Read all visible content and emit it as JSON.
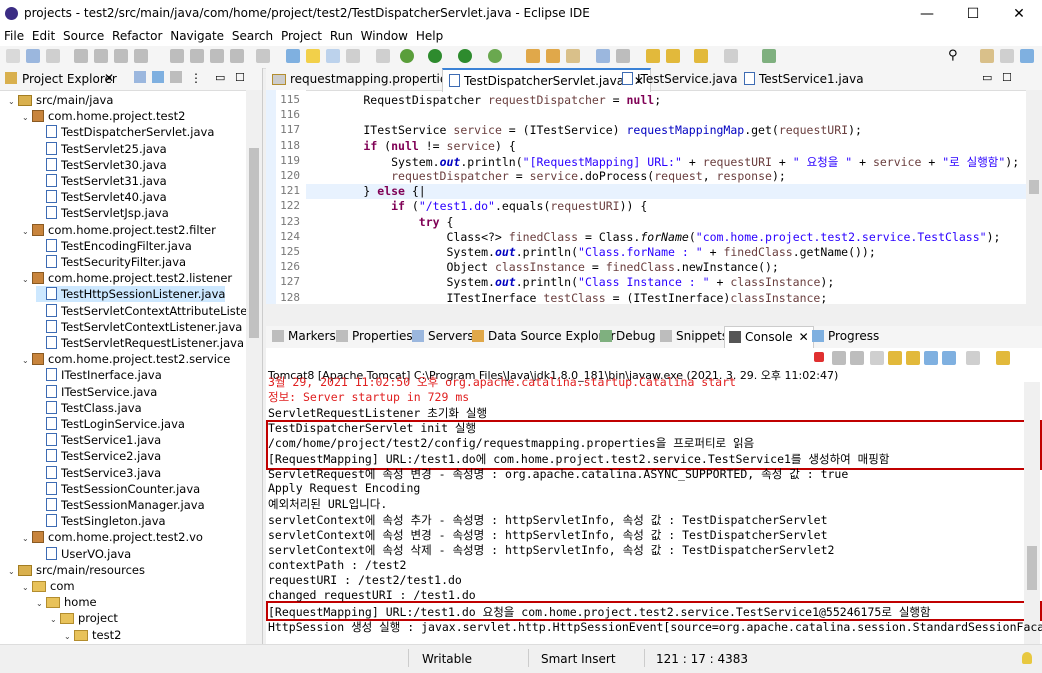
{
  "window": {
    "title": "projects - test2/src/main/java/com/home/project/test2/TestDispatcherServlet.java - Eclipse IDE",
    "minimize": "—",
    "maximize": "☐",
    "close": "✕"
  },
  "menu": [
    "File",
    "Edit",
    "Source",
    "Refactor",
    "Navigate",
    "Search",
    "Project",
    "Run",
    "Window",
    "Help"
  ],
  "project_explorer": {
    "title": "Project Explorer",
    "items": [
      {
        "label": "src/main/java",
        "type": "src",
        "indent": 2,
        "expanded": true
      },
      {
        "label": "com.home.project.test2",
        "type": "pkg",
        "indent": 3,
        "expanded": true
      },
      {
        "label": "TestDispatcherServlet.java",
        "type": "java",
        "indent": 4
      },
      {
        "label": "TestServlet25.java",
        "type": "java",
        "indent": 4
      },
      {
        "label": "TestServlet30.java",
        "type": "java",
        "indent": 4
      },
      {
        "label": "TestServlet31.java",
        "type": "java",
        "indent": 4
      },
      {
        "label": "TestServlet40.java",
        "type": "java",
        "indent": 4
      },
      {
        "label": "TestServletJsp.java",
        "type": "java",
        "indent": 4
      },
      {
        "label": "com.home.project.test2.filter",
        "type": "pkg",
        "indent": 3,
        "expanded": true
      },
      {
        "label": "TestEncodingFilter.java",
        "type": "java",
        "indent": 4
      },
      {
        "label": "TestSecurityFilter.java",
        "type": "java",
        "indent": 4
      },
      {
        "label": "com.home.project.test2.listener",
        "type": "pkg",
        "indent": 3,
        "expanded": true
      },
      {
        "label": "TestHttpSessionListener.java",
        "type": "java",
        "indent": 4,
        "selected": true
      },
      {
        "label": "TestServletContextAttributeListe",
        "type": "java",
        "indent": 4
      },
      {
        "label": "TestServletContextListener.java",
        "type": "java",
        "indent": 4
      },
      {
        "label": "TestServletRequestListener.java",
        "type": "java",
        "indent": 4
      },
      {
        "label": "com.home.project.test2.service",
        "type": "pkg",
        "indent": 3,
        "expanded": true
      },
      {
        "label": "ITestInerface.java",
        "type": "java",
        "indent": 4
      },
      {
        "label": "ITestService.java",
        "type": "java",
        "indent": 4
      },
      {
        "label": "TestClass.java",
        "type": "java",
        "indent": 4
      },
      {
        "label": "TestLoginService.java",
        "type": "java",
        "indent": 4
      },
      {
        "label": "TestService1.java",
        "type": "java",
        "indent": 4
      },
      {
        "label": "TestService2.java",
        "type": "java",
        "indent": 4
      },
      {
        "label": "TestService3.java",
        "type": "java",
        "indent": 4
      },
      {
        "label": "TestSessionCounter.java",
        "type": "java",
        "indent": 4
      },
      {
        "label": "TestSessionManager.java",
        "type": "java",
        "indent": 4
      },
      {
        "label": "TestSingleton.java",
        "type": "java",
        "indent": 4
      },
      {
        "label": "com.home.project.test2.vo",
        "type": "pkg",
        "indent": 3,
        "expanded": true
      },
      {
        "label": "UserVO.java",
        "type": "java",
        "indent": 4
      },
      {
        "label": "src/main/resources",
        "type": "src",
        "indent": 2,
        "expanded": true
      },
      {
        "label": "com",
        "type": "folder",
        "indent": 3,
        "expanded": true
      },
      {
        "label": "home",
        "type": "folder",
        "indent": 4,
        "expanded": true
      },
      {
        "label": "project",
        "type": "folder",
        "indent": 5,
        "expanded": true
      },
      {
        "label": "test2",
        "type": "folder",
        "indent": 6,
        "expanded": true
      }
    ]
  },
  "editor": {
    "tabs": [
      {
        "label": "requestmapping.properties",
        "active": false
      },
      {
        "label": "TestDispatcherServlet.java",
        "active": true
      },
      {
        "label": "ITestService.java",
        "active": false
      },
      {
        "label": "TestService1.java",
        "active": false
      }
    ],
    "current_line": 121,
    "lines": [
      {
        "n": "115",
        "html": "        RequestDispatcher <span class=\"var\">requestDispatcher</span> = <span class=\"kw\">null</span>;"
      },
      {
        "n": "116",
        "html": ""
      },
      {
        "n": "117",
        "html": "        ITestService <span class=\"var\">service</span> = (ITestService) <span class=\"fld\" style=\"font-style:normal;font-weight:normal;color:#0000c0\">requestMappingMap</span>.get(<span class=\"var\">requestURI</span>);"
      },
      {
        "n": "118",
        "html": "        <span class=\"kw\">if</span> (<span class=\"kw\">null</span> != <span class=\"var\">service</span>) {"
      },
      {
        "n": "119",
        "html": "            System.<span class=\"fld\">out</span>.println(<span class=\"str\">\"[RequestMapping] URL:\"</span> + <span class=\"var\">requestURI</span> + <span class=\"str\">\" 요청을 \"</span> + <span class=\"var\">service</span> + <span class=\"str\">\"로 실행함\"</span>);"
      },
      {
        "n": "120",
        "html": "            <span class=\"var\">requestDispatcher</span> = <span class=\"var\">service</span>.doProcess(<span class=\"var\">request</span>, <span class=\"var\">response</span>);"
      },
      {
        "n": "121",
        "html": "        } <span class=\"kw\">else</span> {|"
      },
      {
        "n": "122",
        "html": "            <span class=\"kw\">if</span> (<span class=\"str\">\"/test1.do\"</span>.equals(<span class=\"var\">requestURI</span>)) {"
      },
      {
        "n": "123",
        "html": "                <span class=\"kw\">try</span> {"
      },
      {
        "n": "124",
        "html": "                    Class&lt;?&gt; <span class=\"var\">finedClass</span> = Class.<span class=\"it\">forName</span>(<span class=\"str\">\"com.home.project.test2.service.TestClass\"</span>);"
      },
      {
        "n": "125",
        "html": "                    System.<span class=\"fld\">out</span>.println(<span class=\"str\">\"Class.forName : \"</span> + <span class=\"var\">finedClass</span>.getName());"
      },
      {
        "n": "126",
        "html": "                    Object <span class=\"var\">classInstance</span> = <span class=\"var\">finedClass</span>.newInstance();"
      },
      {
        "n": "127",
        "html": "                    System.<span class=\"fld\">out</span>.println(<span class=\"str\">\"Class Instance : \"</span> + <span class=\"var\">classInstance</span>);"
      },
      {
        "n": "128",
        "html": "                    ITestInerface <span class=\"var\">testClass</span> = (ITestInerface)<span class=\"var\">classInstance</span>;"
      }
    ]
  },
  "console": {
    "tabs": [
      "Markers",
      "Properties",
      "Servers",
      "Data Source Explorer",
      "Debug",
      "Snippets",
      "Console",
      "Progress"
    ],
    "active_tab": "Console",
    "description": "Tomcat8 [Apache Tomcat] C:\\Program Files\\Java\\jdk1.8.0_181\\bin\\javaw.exe  (2021. 3. 29. 오후 11:02:47)",
    "lines": [
      {
        "text": "3월 29, 2021 11:02:50 오후 org.apache.catalina.startup.Catalina start",
        "red": true
      },
      {
        "text": "정보: Server startup in 729 ms",
        "red": true
      },
      {
        "text": "ServletRequestListener 초기화 실행",
        "red": false
      },
      {
        "text": "TestDispatcherServlet init 실행",
        "red": false
      },
      {
        "text": "/com/home/project/test2/config/requestmapping.properties을 프로퍼티로 읽음",
        "red": false
      },
      {
        "text": "[RequestMapping] URL:/test1.do에 com.home.project.test2.service.TestService1를 생성하여 매핑함",
        "red": false
      },
      {
        "text": "ServletRequest에 속성 변경 - 속성명 : org.apache.catalina.ASYNC_SUPPORTED, 속성 값 : true",
        "red": false
      },
      {
        "text": "Apply Request Encoding",
        "red": false
      },
      {
        "text": "예외처리된 URL입니다.",
        "red": false
      },
      {
        "text": "servletContext에 속성 추가 - 속성명 : httpServletInfo, 속성 값 : TestDispatcherServlet",
        "red": false
      },
      {
        "text": "servletContext에 속성 변경 - 속성명 : httpServletInfo, 속성 값 : TestDispatcherServlet",
        "red": false
      },
      {
        "text": "servletContext에 속성 삭제 - 속성명 : httpServletInfo, 속성 값 : TestDispatcherServlet2",
        "red": false
      },
      {
        "text": "contextPath : /test2",
        "red": false
      },
      {
        "text": "requestURI : /test2/test1.do",
        "red": false
      },
      {
        "text": "changed requestURI : /test1.do",
        "red": false
      },
      {
        "text": "[RequestMapping] URL:/test1.do 요청을 com.home.project.test2.service.TestService1@55246175로 실행함",
        "red": false
      },
      {
        "text": "HttpSession 생성 실행 : javax.servlet.http.HttpSessionEvent[source=org.apache.catalina.session.StandardSessionFaca",
        "red": false
      }
    ]
  },
  "status": {
    "mode": "Writable",
    "insert": "Smart Insert",
    "position": "121 : 17 : 4383"
  },
  "colors": {
    "highlight_box": "#c00000",
    "keyword": "#7f0055",
    "string": "#2a00ff",
    "console_red": "#e02020"
  }
}
